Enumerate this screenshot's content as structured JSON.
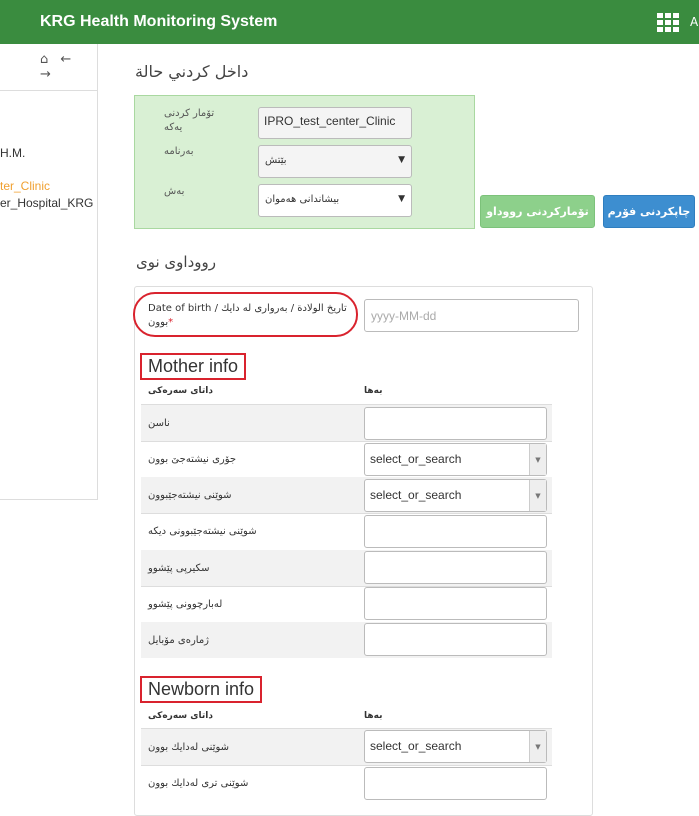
{
  "header": {
    "app_title": "KRG Health Monitoring System",
    "user_initial": "A",
    "apps_icon": "grid-apps-icon"
  },
  "sidebar": {
    "nav_icons": [
      "home-icon",
      "arrow-left-icon",
      "arrow-right-icon"
    ],
    "nav_glyphs": "⌂ ← →",
    "lines": [
      {
        "text": "H.M.",
        "color": "#333333"
      },
      {
        "text": "ter_Clinic",
        "color": "#f0a030"
      },
      {
        "text": "er_Hospital_KRG",
        "color": "#333333"
      }
    ]
  },
  "main": {
    "heading": "داخل كردني حالة",
    "registration": {
      "fields": [
        {
          "label": "تۆمار كردنی يەكە",
          "value": "IPRO_test_center_Clinic",
          "kind": "input"
        },
        {
          "label": "بەرنامە",
          "value": "بێتش",
          "kind": "select"
        },
        {
          "label": "بەش",
          "value": "بیشاندانی هەموان",
          "kind": "select"
        }
      ]
    },
    "buttons": {
      "register_event": "تۆماركردنی رووداو",
      "print_form": "چاپكردنی فۆرم"
    },
    "new_event_heading": "رووداوی نوی",
    "dob": {
      "label": "Date of birth / تاريخ الولادة / بەرواری لە دايك بوون",
      "required_mark": "*",
      "placeholder": "yyyy-MM-dd"
    },
    "columns": {
      "data_element": "داتای سەرەكی",
      "value": "بەها"
    },
    "mother_info": {
      "title": "Mother info",
      "rows": [
        {
          "label": "ناسن",
          "kind": "input"
        },
        {
          "label": "جۆری نیشتەجێ بوون",
          "kind": "select",
          "value": "select_or_search"
        },
        {
          "label": "شوێنی نیشتەجێبوون",
          "kind": "select",
          "value": "select_or_search"
        },
        {
          "label": "شوێنی نیشتەجێبوونی دیكە",
          "kind": "input"
        },
        {
          "label": "سكیرپی پێشوو",
          "kind": "input"
        },
        {
          "label": "لەبارچوونی پێشوو",
          "kind": "input"
        },
        {
          "label": "ژمارەی مۆبایل",
          "kind": "input"
        }
      ]
    },
    "newborn_info": {
      "title": "Newborn info",
      "rows": [
        {
          "label": "شوێنی لەدایك بوون",
          "kind": "select",
          "value": "select_or_search"
        },
        {
          "label": "شوێنی تری لەدایك بوون",
          "kind": "input"
        }
      ]
    }
  }
}
